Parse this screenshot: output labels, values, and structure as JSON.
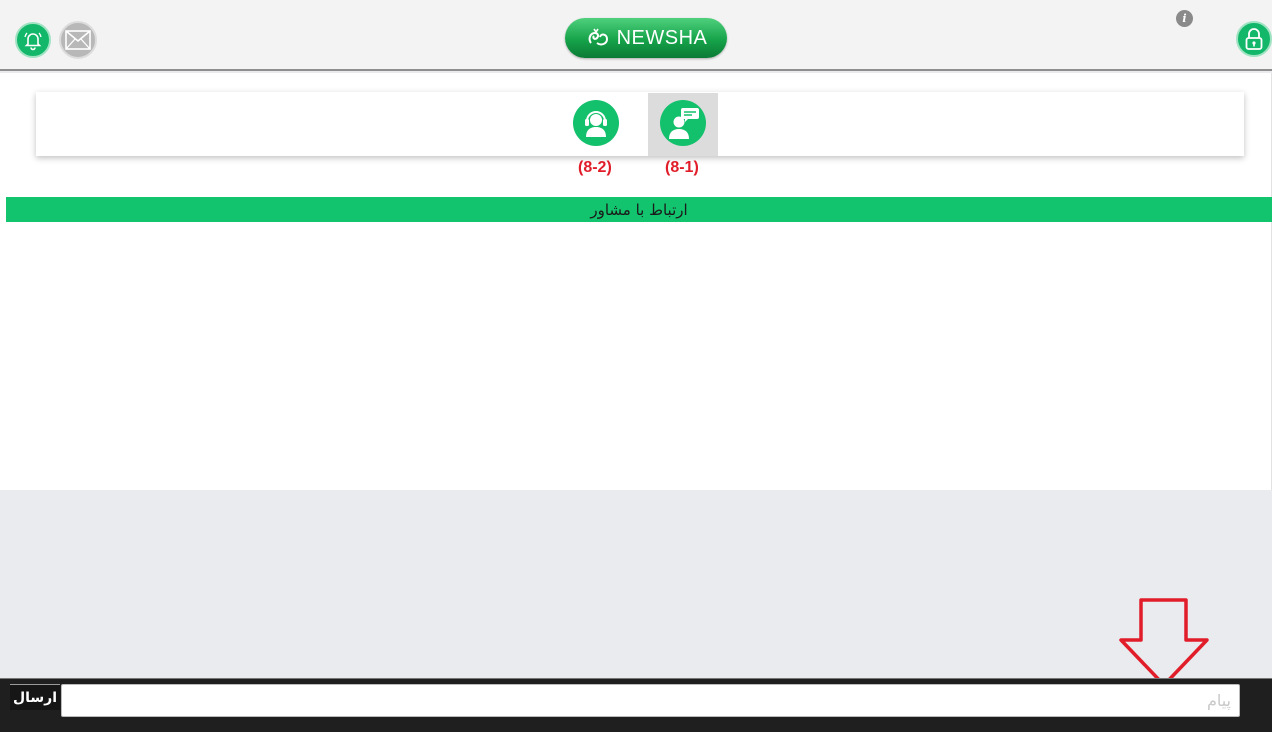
{
  "header": {
    "logo_text": "NEWSHA",
    "info_label": "i",
    "brand_color": "#12b76a"
  },
  "tabs": [
    {
      "code": "(8-2)",
      "icon": "headset-support-icon"
    },
    {
      "code": "(8-1)",
      "icon": "chat-user-icon",
      "selected": true
    }
  ],
  "consultant": {
    "title": "ارتباط با مشاور"
  },
  "composer": {
    "send_label": "ارسال",
    "placeholder": "پیام",
    "value": ""
  },
  "accent_colors": {
    "code_text": "#e11d2a",
    "arrow": "#e11d2a",
    "bar": "#12c46d"
  }
}
